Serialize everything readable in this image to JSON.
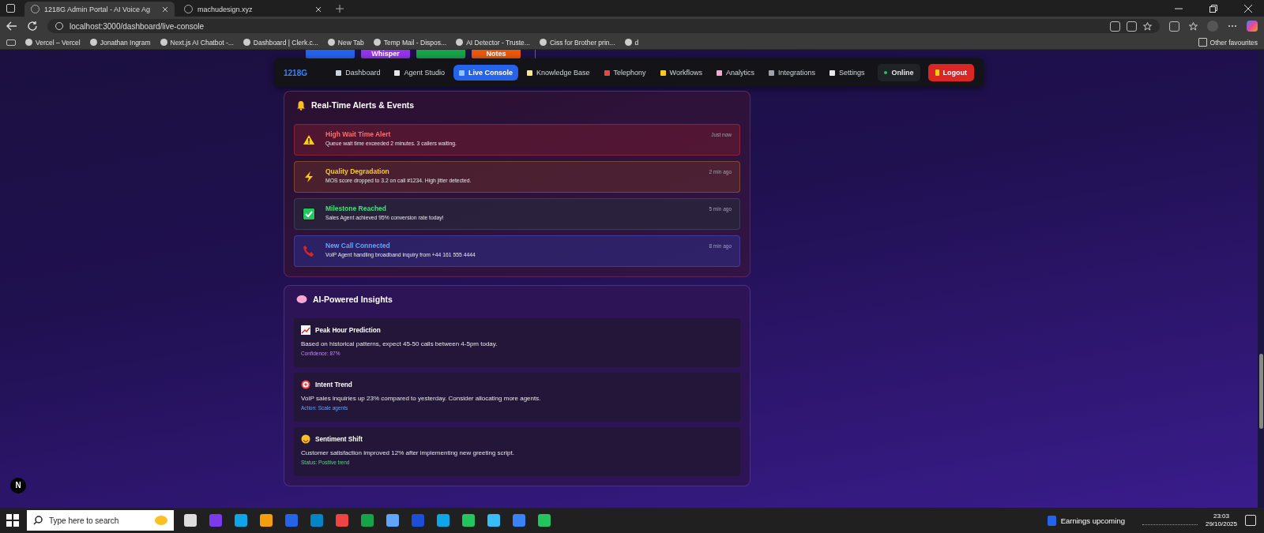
{
  "browser": {
    "tabs": [
      {
        "title": "1218G Admin Portal - AI Voice Ag",
        "selected": true
      },
      {
        "title": "machudesign.xyz",
        "selected": false
      }
    ],
    "address": "localhost:3000/dashboard/live-console",
    "bookmarks": [
      "Vercel – Vercel",
      "Jonathan Ingram",
      "Next.js AI Chatbot -...",
      "Dashboard | Clerk.c...",
      "New Tab",
      "Temp Mail - Dispos...",
      "AI Detector - Truste...",
      "Ciss for Brother prin...",
      "d"
    ],
    "other_favourites": "Other favourites"
  },
  "quick_actions": [
    {
      "kind": "blue"
    },
    {
      "label": "Whisper",
      "kind": "purple"
    },
    {
      "kind": "green"
    },
    {
      "label": "Notes",
      "kind": "orange"
    }
  ],
  "dev_badge": "N",
  "nav": {
    "logo": "1218G",
    "items": [
      {
        "label": "Dashboard",
        "selected": false
      },
      {
        "label": "Agent Studio",
        "selected": false
      },
      {
        "label": "Live Console",
        "selected": true
      },
      {
        "label": "Knowledge Base",
        "selected": false
      },
      {
        "label": "Telephony",
        "selected": false
      },
      {
        "label": "Workflows",
        "selected": false
      },
      {
        "label": "Analytics",
        "selected": false
      },
      {
        "label": "Integrations",
        "selected": false
      },
      {
        "label": "Settings",
        "selected": false
      }
    ],
    "status": {
      "label": "Online",
      "on": true
    },
    "logout": "Logout"
  },
  "alerts": {
    "title": "Real-Time Alerts & Events",
    "items": [
      {
        "kind": "warning",
        "title": "High Wait Time Alert",
        "text": "Queue wait time exceeded 2 minutes. 3 callers waiting.",
        "time": "Just now"
      },
      {
        "kind": "quality",
        "title": "Quality Degradation",
        "text": "MOS score dropped to 3.2 on call #1234. High jitter detected.",
        "time": "2 min ago"
      },
      {
        "kind": "success",
        "title": "Milestone Reached",
        "text": "Sales Agent achieved 95% conversion rate today!",
        "time": "5 min ago"
      },
      {
        "kind": "call",
        "title": "New Call Connected",
        "text": "VoIP Agent handling broadband inquiry from +44 161 555 4444",
        "time": "8 min ago"
      }
    ]
  },
  "insights": {
    "title": "AI-Powered Insights",
    "items": [
      {
        "kind": "confidence",
        "title": "Peak Hour Prediction",
        "text": "Based on historical patterns, expect 45-50 calls between 4-5pm today.",
        "footer": "Confidence: 87%"
      },
      {
        "kind": "action",
        "title": "Intent Trend",
        "text": "VoIP sales inquiries up 23% compared to yesterday. Consider allocating more agents.",
        "footer": "Action: Scale agents"
      },
      {
        "kind": "status",
        "title": "Sentiment Shift",
        "text": "Customer satisfaction improved 12% after implementing new greeting script.",
        "footer": "Status: Positive trend"
      }
    ]
  },
  "taskbar": {
    "search_placeholder": "Type here to search",
    "news": "Earnings upcoming",
    "time": "23:03",
    "date": "29/10/2025"
  }
}
